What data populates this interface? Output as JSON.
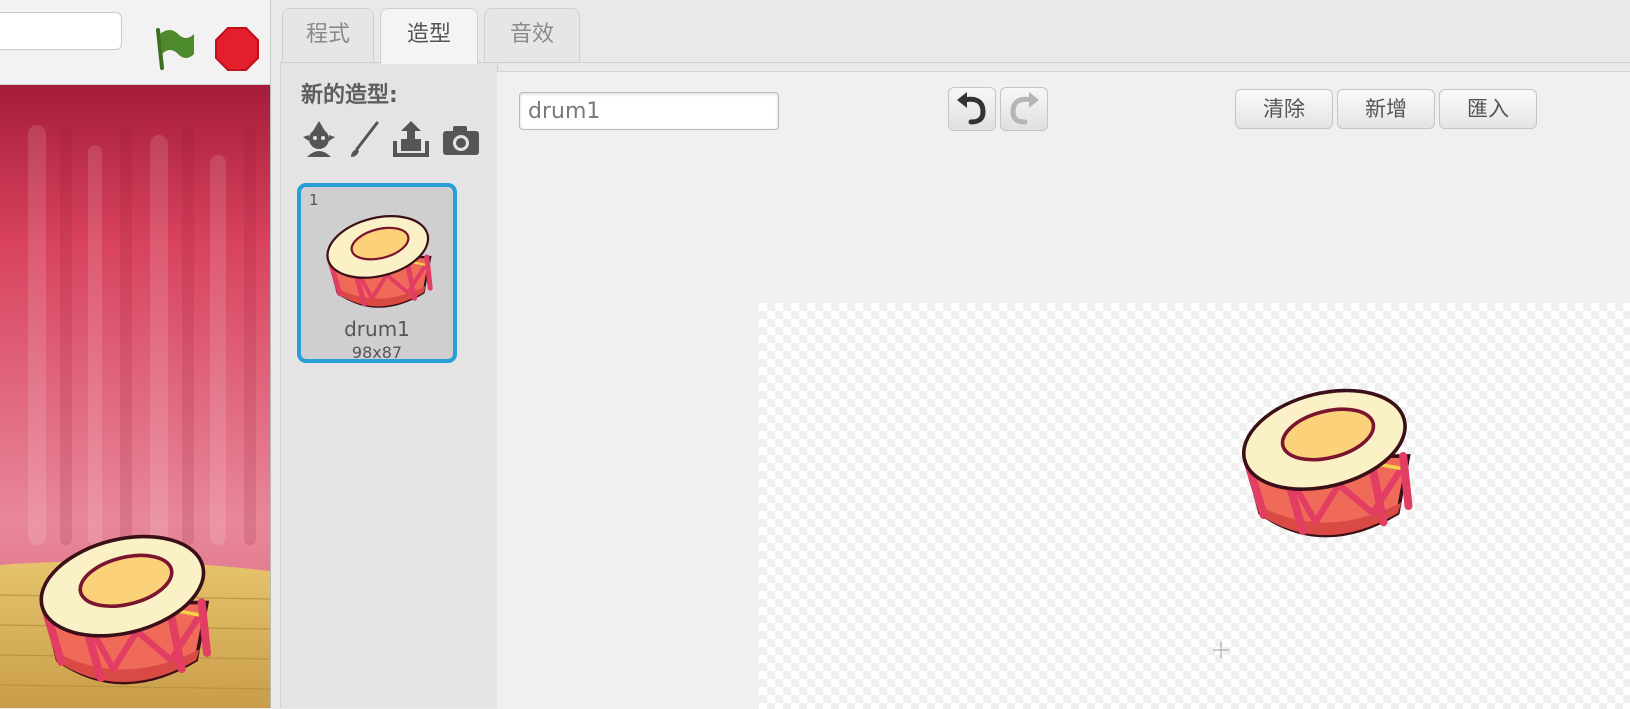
{
  "tabs": [
    {
      "label": "程式",
      "active": false
    },
    {
      "label": "造型",
      "active": true
    },
    {
      "label": "音效",
      "active": false
    }
  ],
  "stage": {
    "icons": {
      "start": "green-flag-icon",
      "stop": "stop-sign-icon"
    },
    "colors": {
      "flag": "#4d8a2c",
      "stop": "#e41e2d",
      "curtain": "#c83a52",
      "floor": "#d6b463"
    }
  },
  "costumes_panel": {
    "new_costume_label": "新的造型:",
    "new_costume_icons": [
      "sprite-library-icon",
      "paint-brush-icon",
      "upload-icon",
      "camera-icon"
    ],
    "costumes": [
      {
        "number": "1",
        "name": "drum1",
        "size": "98x87",
        "selected": true
      }
    ]
  },
  "editor": {
    "costume_name_value": "drum1",
    "undo_icon": "undo-icon",
    "redo_icon": "redo-icon",
    "buttons": {
      "clear": "清除",
      "add": "新增",
      "import": "匯入"
    }
  },
  "accent_color": "#27a0d8"
}
